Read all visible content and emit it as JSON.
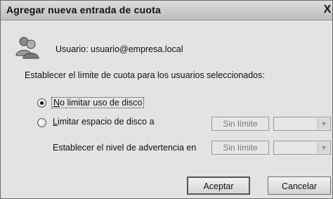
{
  "window": {
    "title": "Agregar nueva entrada de cuota",
    "close_glyph": "X"
  },
  "user": {
    "icon": "users-icon",
    "label": "Usuario: usuario@empresa.local"
  },
  "instruction": "Establecer el límite de cuota para los usuarios seleccionados:",
  "options": {
    "no_limit": {
      "label": "No limitar uso de disco",
      "accel": "N",
      "rest": "o limitar uso de disco",
      "checked": true
    },
    "limit": {
      "label": "Limitar espacio de disco a",
      "accel": "L",
      "rest": "imitar espacio de disco a",
      "checked": false,
      "value": "Sin límite"
    },
    "warning": {
      "label": "Establecer el nivel de advertencia en",
      "value": "Sin límite"
    }
  },
  "buttons": {
    "accept": "Aceptar",
    "cancel": "Cancelar"
  },
  "colors": {
    "background": "#e3e3e3",
    "titlebar": "#c9c9c9"
  }
}
